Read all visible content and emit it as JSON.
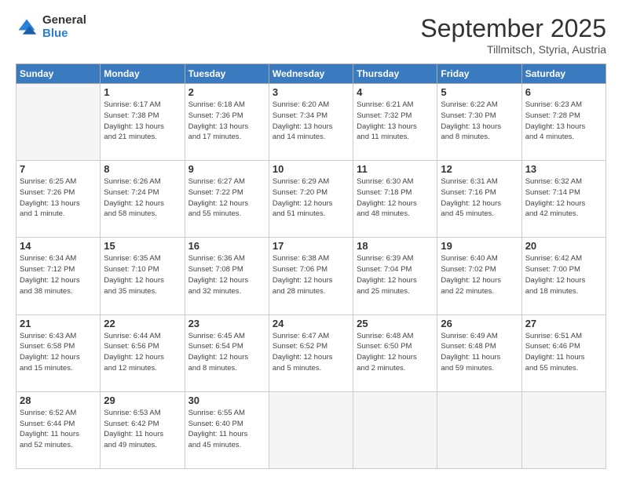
{
  "logo": {
    "general": "General",
    "blue": "Blue"
  },
  "header": {
    "month": "September 2025",
    "location": "Tillmitsch, Styria, Austria"
  },
  "weekdays": [
    "Sunday",
    "Monday",
    "Tuesday",
    "Wednesday",
    "Thursday",
    "Friday",
    "Saturday"
  ],
  "weeks": [
    [
      {
        "day": "",
        "info": ""
      },
      {
        "day": "1",
        "info": "Sunrise: 6:17 AM\nSunset: 7:38 PM\nDaylight: 13 hours\nand 21 minutes."
      },
      {
        "day": "2",
        "info": "Sunrise: 6:18 AM\nSunset: 7:36 PM\nDaylight: 13 hours\nand 17 minutes."
      },
      {
        "day": "3",
        "info": "Sunrise: 6:20 AM\nSunset: 7:34 PM\nDaylight: 13 hours\nand 14 minutes."
      },
      {
        "day": "4",
        "info": "Sunrise: 6:21 AM\nSunset: 7:32 PM\nDaylight: 13 hours\nand 11 minutes."
      },
      {
        "day": "5",
        "info": "Sunrise: 6:22 AM\nSunset: 7:30 PM\nDaylight: 13 hours\nand 8 minutes."
      },
      {
        "day": "6",
        "info": "Sunrise: 6:23 AM\nSunset: 7:28 PM\nDaylight: 13 hours\nand 4 minutes."
      }
    ],
    [
      {
        "day": "7",
        "info": "Sunrise: 6:25 AM\nSunset: 7:26 PM\nDaylight: 13 hours\nand 1 minute."
      },
      {
        "day": "8",
        "info": "Sunrise: 6:26 AM\nSunset: 7:24 PM\nDaylight: 12 hours\nand 58 minutes."
      },
      {
        "day": "9",
        "info": "Sunrise: 6:27 AM\nSunset: 7:22 PM\nDaylight: 12 hours\nand 55 minutes."
      },
      {
        "day": "10",
        "info": "Sunrise: 6:29 AM\nSunset: 7:20 PM\nDaylight: 12 hours\nand 51 minutes."
      },
      {
        "day": "11",
        "info": "Sunrise: 6:30 AM\nSunset: 7:18 PM\nDaylight: 12 hours\nand 48 minutes."
      },
      {
        "day": "12",
        "info": "Sunrise: 6:31 AM\nSunset: 7:16 PM\nDaylight: 12 hours\nand 45 minutes."
      },
      {
        "day": "13",
        "info": "Sunrise: 6:32 AM\nSunset: 7:14 PM\nDaylight: 12 hours\nand 42 minutes."
      }
    ],
    [
      {
        "day": "14",
        "info": "Sunrise: 6:34 AM\nSunset: 7:12 PM\nDaylight: 12 hours\nand 38 minutes."
      },
      {
        "day": "15",
        "info": "Sunrise: 6:35 AM\nSunset: 7:10 PM\nDaylight: 12 hours\nand 35 minutes."
      },
      {
        "day": "16",
        "info": "Sunrise: 6:36 AM\nSunset: 7:08 PM\nDaylight: 12 hours\nand 32 minutes."
      },
      {
        "day": "17",
        "info": "Sunrise: 6:38 AM\nSunset: 7:06 PM\nDaylight: 12 hours\nand 28 minutes."
      },
      {
        "day": "18",
        "info": "Sunrise: 6:39 AM\nSunset: 7:04 PM\nDaylight: 12 hours\nand 25 minutes."
      },
      {
        "day": "19",
        "info": "Sunrise: 6:40 AM\nSunset: 7:02 PM\nDaylight: 12 hours\nand 22 minutes."
      },
      {
        "day": "20",
        "info": "Sunrise: 6:42 AM\nSunset: 7:00 PM\nDaylight: 12 hours\nand 18 minutes."
      }
    ],
    [
      {
        "day": "21",
        "info": "Sunrise: 6:43 AM\nSunset: 6:58 PM\nDaylight: 12 hours\nand 15 minutes."
      },
      {
        "day": "22",
        "info": "Sunrise: 6:44 AM\nSunset: 6:56 PM\nDaylight: 12 hours\nand 12 minutes."
      },
      {
        "day": "23",
        "info": "Sunrise: 6:45 AM\nSunset: 6:54 PM\nDaylight: 12 hours\nand 8 minutes."
      },
      {
        "day": "24",
        "info": "Sunrise: 6:47 AM\nSunset: 6:52 PM\nDaylight: 12 hours\nand 5 minutes."
      },
      {
        "day": "25",
        "info": "Sunrise: 6:48 AM\nSunset: 6:50 PM\nDaylight: 12 hours\nand 2 minutes."
      },
      {
        "day": "26",
        "info": "Sunrise: 6:49 AM\nSunset: 6:48 PM\nDaylight: 11 hours\nand 59 minutes."
      },
      {
        "day": "27",
        "info": "Sunrise: 6:51 AM\nSunset: 6:46 PM\nDaylight: 11 hours\nand 55 minutes."
      }
    ],
    [
      {
        "day": "28",
        "info": "Sunrise: 6:52 AM\nSunset: 6:44 PM\nDaylight: 11 hours\nand 52 minutes."
      },
      {
        "day": "29",
        "info": "Sunrise: 6:53 AM\nSunset: 6:42 PM\nDaylight: 11 hours\nand 49 minutes."
      },
      {
        "day": "30",
        "info": "Sunrise: 6:55 AM\nSunset: 6:40 PM\nDaylight: 11 hours\nand 45 minutes."
      },
      {
        "day": "",
        "info": ""
      },
      {
        "day": "",
        "info": ""
      },
      {
        "day": "",
        "info": ""
      },
      {
        "day": "",
        "info": ""
      }
    ]
  ]
}
